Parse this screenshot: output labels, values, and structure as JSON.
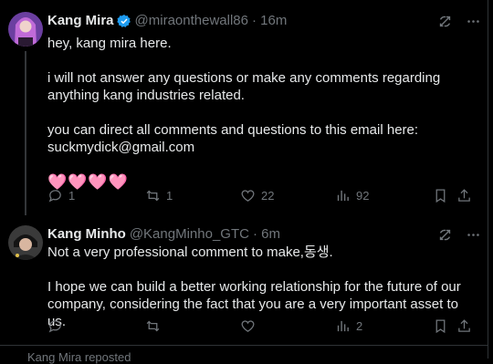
{
  "tweet1": {
    "name": "Kang Mira",
    "handle": "@miraonthewall86",
    "time": "· 16m",
    "lines": [
      "hey, kang mira here.",
      "i will not answer any questions or make any comments regarding anything kang industries related.",
      "you can direct all comments and questions to this email here: suckmydick@gmail.com"
    ],
    "hearts": "🩷🩷🩷🩷",
    "replies": "1",
    "reposts": "1",
    "likes": "22",
    "views": "92"
  },
  "tweet2": {
    "name": "Kang Minho",
    "handle": "@KangMinho_GTC",
    "time": "· 6m",
    "lines": [
      "Not a very professional comment to make,동생.",
      "I hope we can build a better working relationship for the future of our company, considering the fact that you are a very important asset to us."
    ],
    "views": "2"
  },
  "footer": {
    "text": "Kang Mira reposted"
  },
  "colors": {
    "accent": "#1d9bf0",
    "muted": "#71767b",
    "heart": "#f7a8c8"
  }
}
